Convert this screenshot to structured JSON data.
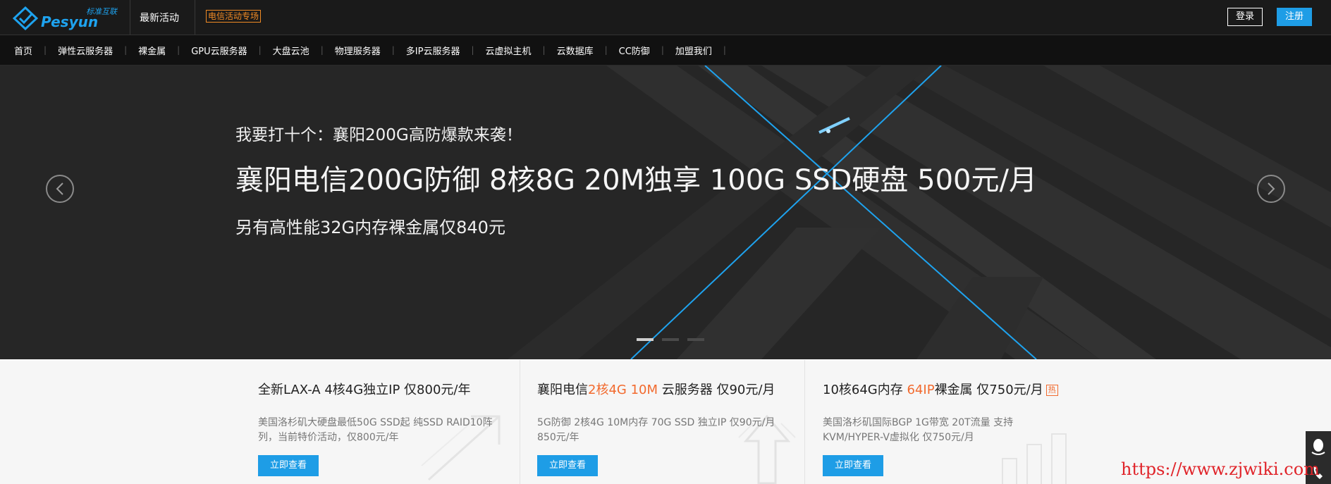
{
  "header": {
    "brand": "Pesyun",
    "slogan": "标准互联",
    "latest_label": "最新活动",
    "promo_label": "电信活动专场",
    "login_label": "登录",
    "register_label": "注册"
  },
  "nav": {
    "items": [
      {
        "label": "首页"
      },
      {
        "label": "弹性云服务器"
      },
      {
        "label": "裸金属"
      },
      {
        "label": "GPU云服务器"
      },
      {
        "label": "大盘云池"
      },
      {
        "label": "物理服务器"
      },
      {
        "label": "多IP云服务器"
      },
      {
        "label": "云虚拟主机"
      },
      {
        "label": "云数据库"
      },
      {
        "label": "CC防御"
      },
      {
        "label": "加盟我们"
      }
    ]
  },
  "hero": {
    "line1": "我要打十个：襄阳200G高防爆款来袭！",
    "line2": "襄阳电信200G防御 8核8G 20M独享 100G SSD硬盘 500元/月",
    "line3": "另有高性能32G内存裸金属仅840元",
    "slides_total": 3,
    "active_slide": 1,
    "accent_color": "#1ea3ef"
  },
  "cards": [
    {
      "title_pre": "全新LAX-A 4核4G独立IP 仅800元/年",
      "title_hl": "",
      "title_post": "",
      "badge": "",
      "desc": "美国洛杉矶大硬盘最低50G SSD起 纯SSD RAID10阵列，当前特价活动，仅800元/年",
      "button": "立即查看"
    },
    {
      "title_pre": "襄阳电信",
      "title_hl": "2核4G 10M",
      "title_post": " 云服务器 仅90元/月",
      "badge": "",
      "desc": "5G防御 2核4G 10M内存 70G SSD 独立IP 仅90元/月  850元/年",
      "button": "立即查看"
    },
    {
      "title_pre": "10核64G内存 ",
      "title_hl": "64IP",
      "title_post": "裸金属 仅750元/月",
      "badge": "热",
      "desc": "美国洛杉矶国际BGP  1G带宽 20T流量 支持KVM/HYPER-V虚拟化 仅750元/月",
      "button": "立即查看"
    }
  ],
  "watermark": "https://www.zjwiki.com",
  "colors": {
    "primary": "#1e9de6",
    "highlight": "#f26a2e",
    "promo": "#f08a24",
    "watermark": "#e0242a"
  }
}
